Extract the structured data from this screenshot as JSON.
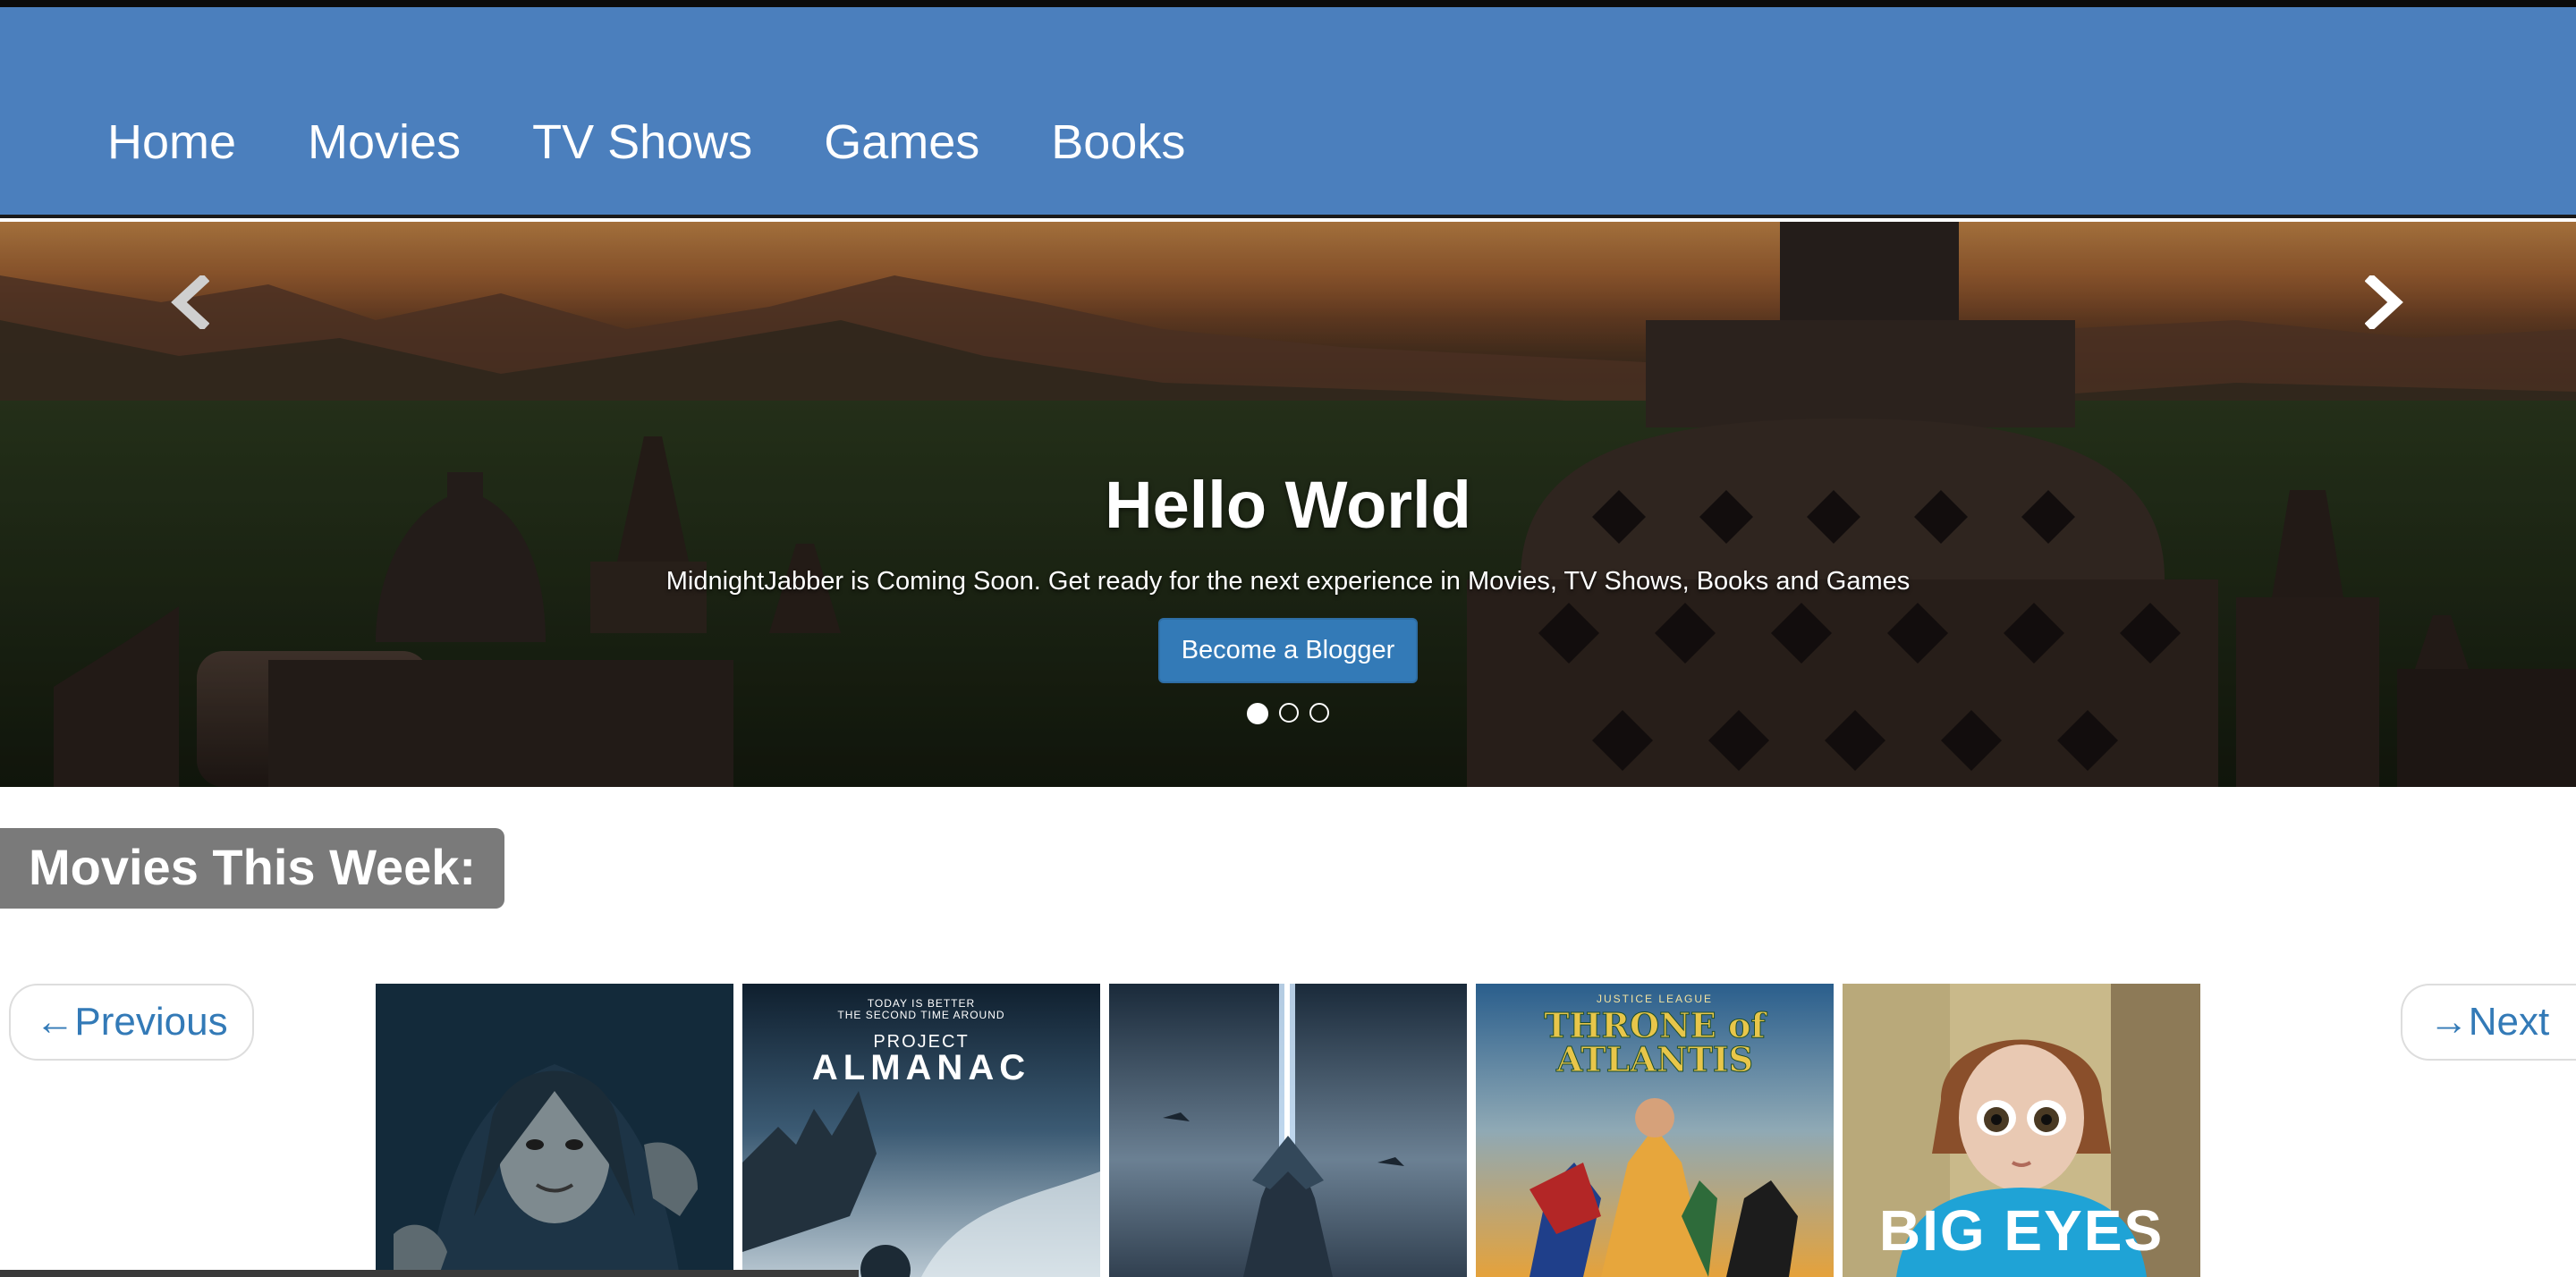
{
  "nav": {
    "items": [
      {
        "label": "Home"
      },
      {
        "label": "Movies"
      },
      {
        "label": "TV Shows"
      },
      {
        "label": "Games"
      },
      {
        "label": "Books"
      }
    ]
  },
  "hero": {
    "title": "Hello World",
    "subtitle": "MidnightJabber is Coming Soon. Get ready for the next experience in Movies, TV Shows, Books and Games",
    "cta_label": "Become a Blogger",
    "slide_count": 3,
    "active_slide": 1
  },
  "section": {
    "title": "Movies This Week:"
  },
  "pager": {
    "previous_label": "←Previous",
    "next_label": "→Next"
  },
  "posters": [
    {
      "text_top": "",
      "text_main": ""
    },
    {
      "text_top": "TODAY IS BETTER\nTHE SECOND TIME AROUND",
      "text_sub": "PROJECT",
      "text_main": "ALMANAC"
    },
    {
      "text_top": "",
      "text_main": ""
    },
    {
      "text_top": "JUSTICE LEAGUE",
      "text_main": "THRONE of ATLANTIS"
    },
    {
      "text_top": "",
      "text_main": "BIG EYES"
    }
  ],
  "colors": {
    "navbar": "#4b7fbd",
    "cta": "#337ab7",
    "link": "#337ab7",
    "section_badge": "#7a7a7a"
  }
}
